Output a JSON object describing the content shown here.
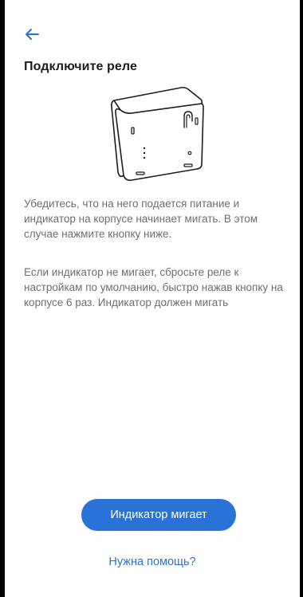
{
  "header": {
    "back_icon": "arrow-left-icon",
    "title": "Подключите реле"
  },
  "illustration": {
    "icon": "relay-device-icon"
  },
  "instructions": {
    "paragraph1": "Убедитесь, что на него подается питание и индикатор на корпусе начинает мигать. В этом случае нажмите кнопку ниже.",
    "paragraph2": "Если индикатор не мигает, сбросьте реле к настройкам по умолчанию, быстро нажав кнопку на корпусе 6 раз. Индикатор должен мигать"
  },
  "actions": {
    "primary_label": "Индикатор мигает",
    "help_label": "Нужна помощь?"
  },
  "colors": {
    "accent": "#2a72d6",
    "title": "#1d1d1f",
    "body_text": "#6e6e73"
  }
}
